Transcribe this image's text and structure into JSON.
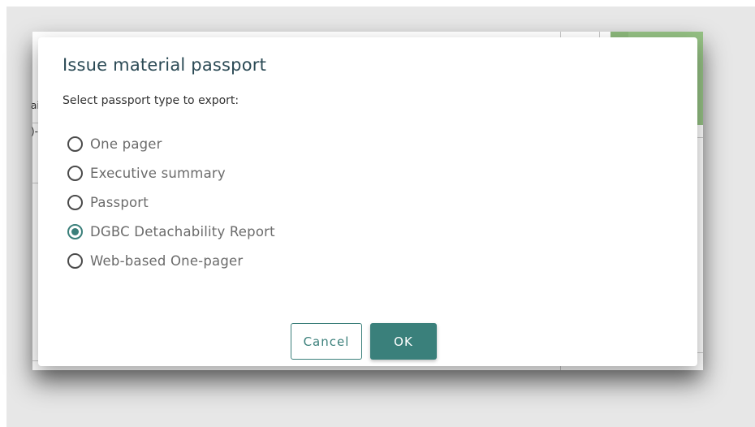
{
  "dialog": {
    "title": "Issue material passport",
    "prompt": "Select passport type to export:",
    "options": [
      {
        "label": "One pager",
        "selected": false
      },
      {
        "label": "Executive summary",
        "selected": false
      },
      {
        "label": "Passport",
        "selected": false
      },
      {
        "label": "DGBC Detachability Report",
        "selected": true
      },
      {
        "label": "Web-based One-pager",
        "selected": false
      }
    ],
    "cancel_label": "Cancel",
    "ok_label": "OK"
  },
  "background": {
    "fragment_1": "ai",
    "fragment_2": ")-"
  },
  "colors": {
    "accent": "#3a807b",
    "title": "#2b4a55",
    "background_green": "#8bb87a"
  }
}
